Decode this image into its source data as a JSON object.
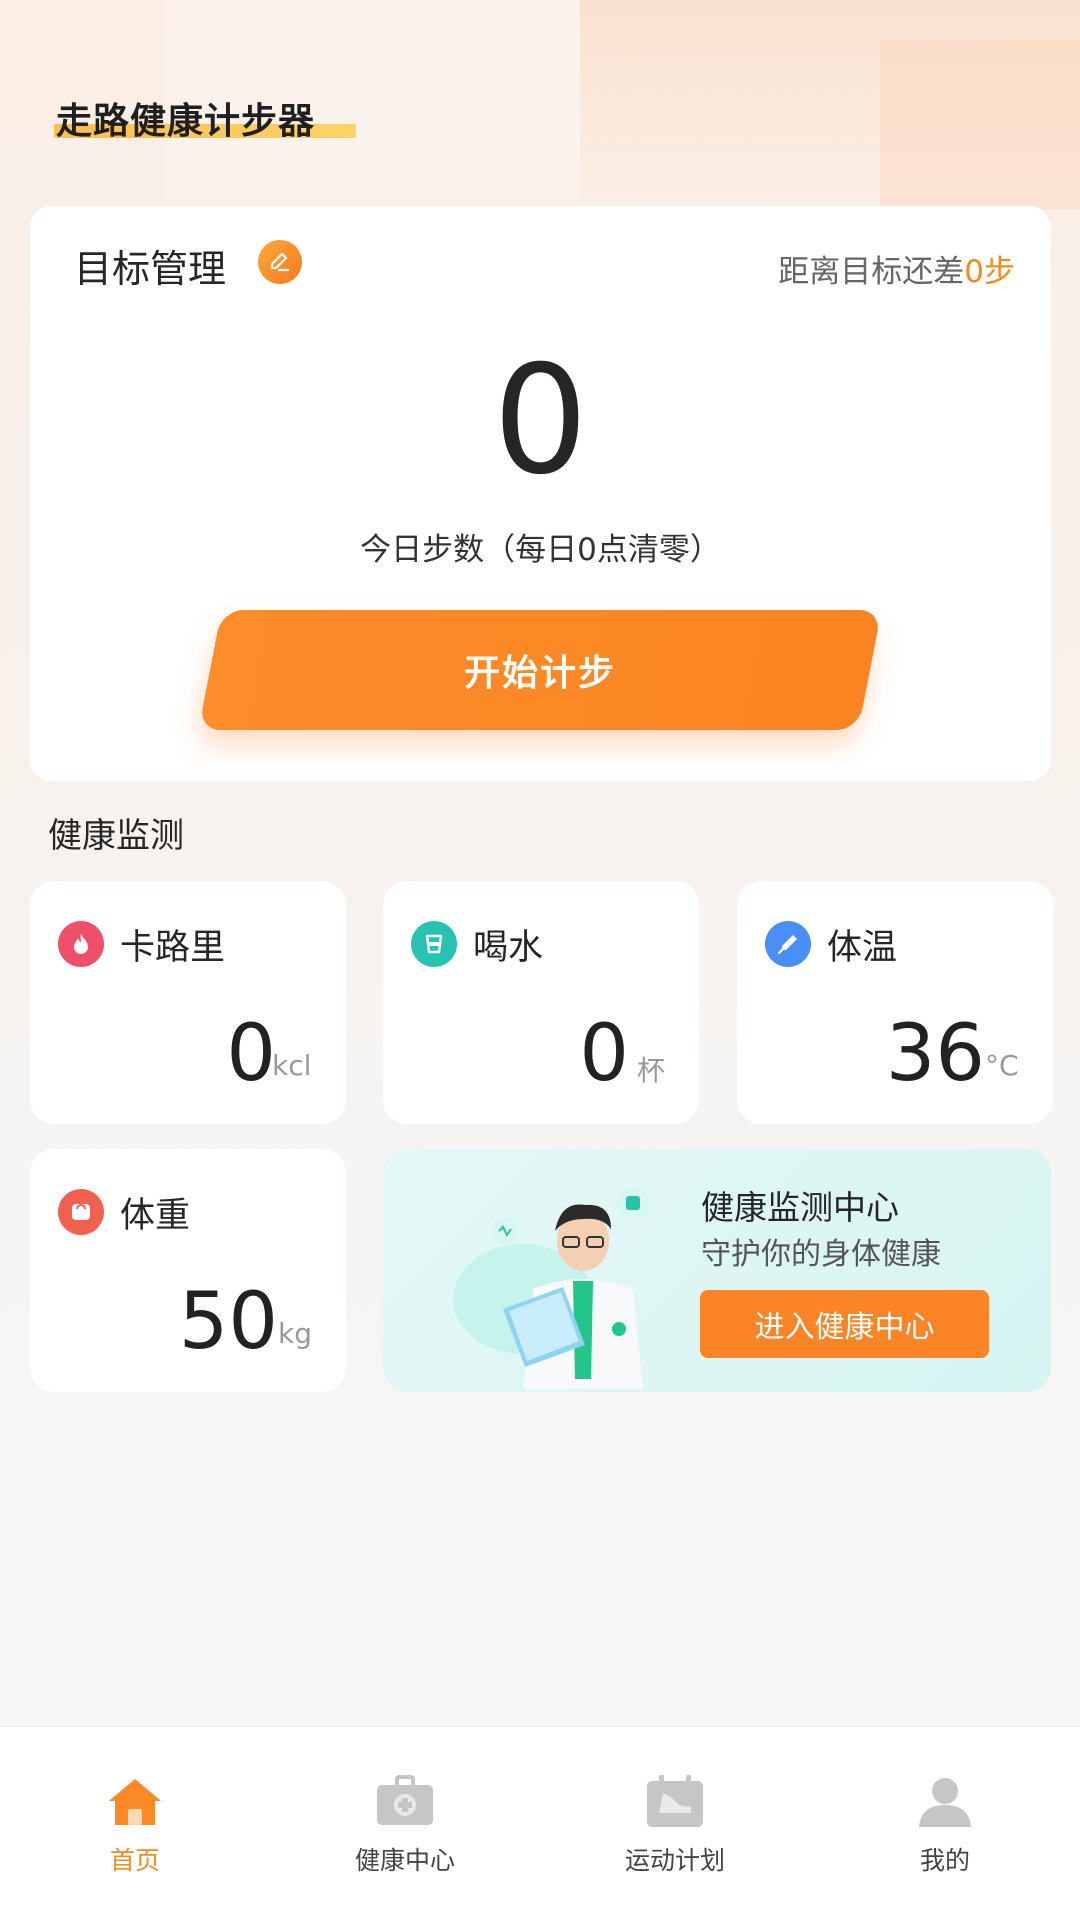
{
  "app": {
    "title": "走路健康计步器"
  },
  "goal": {
    "title": "目标管理",
    "remaining_prefix": "距离目标还差",
    "remaining_value": "0步",
    "steps": "0",
    "caption": "今日步数（每日0点清零）",
    "start_button": "开始计步"
  },
  "monitor": {
    "section_title": "健康监测",
    "calorie": {
      "label": "卡路里",
      "value": "0",
      "unit": "kcl"
    },
    "water": {
      "label": "喝水",
      "value": "0",
      "unit": "杯"
    },
    "temperature": {
      "label": "体温",
      "value": "36",
      "unit": "°C"
    },
    "weight": {
      "label": "体重",
      "value": "50",
      "unit": "kg"
    }
  },
  "health_center": {
    "title": "健康监测中心",
    "subtitle": "守护你的身体健康",
    "button": "进入健康中心"
  },
  "nav": {
    "items": [
      {
        "label": "首页",
        "icon": "home-icon",
        "active": true
      },
      {
        "label": "健康中心",
        "icon": "medical-kit-icon",
        "active": false
      },
      {
        "label": "运动计划",
        "icon": "sneaker-calendar-icon",
        "active": false
      },
      {
        "label": "我的",
        "icon": "user-icon",
        "active": false
      }
    ]
  },
  "colors": {
    "accent": "#fb8426",
    "calorie_icon": "#f04f6b",
    "water_icon": "#27c2b0",
    "temperature_icon": "#4a8ff5",
    "weight_icon": "#f2604f"
  }
}
